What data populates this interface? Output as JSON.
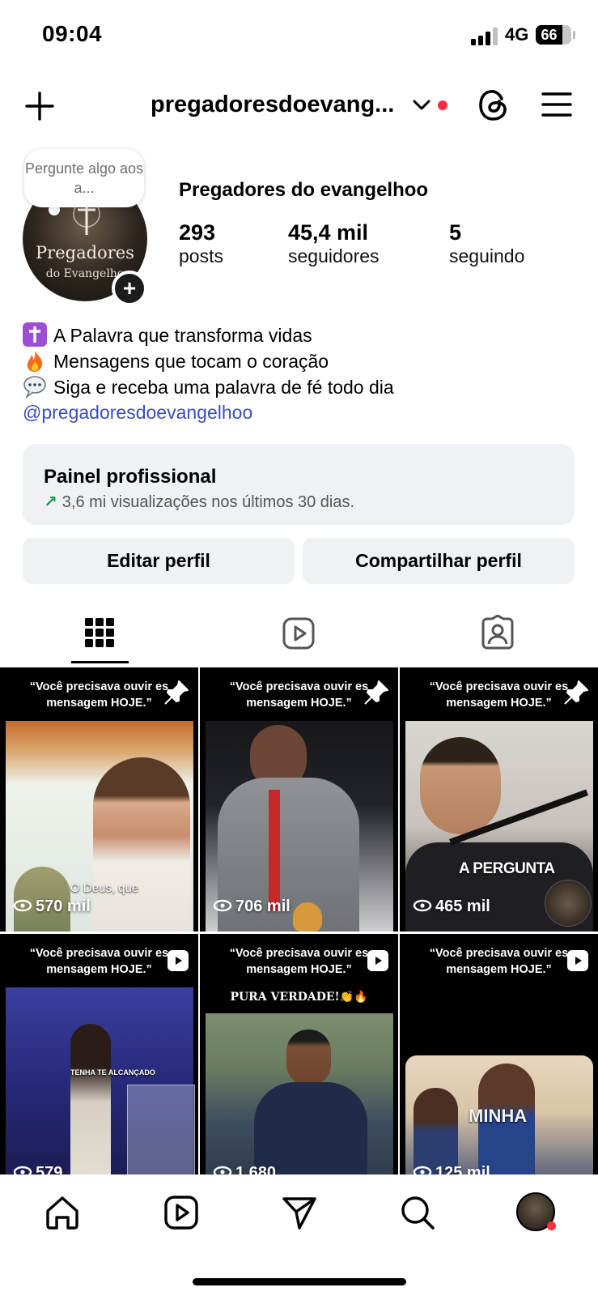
{
  "status_bar": {
    "time": "09:04",
    "network": "4G",
    "battery": "66"
  },
  "header": {
    "username": "pregadoresdoevang..."
  },
  "profile": {
    "name": "Pregadores do evangelhoo",
    "bubble_text": "Pergunte algo aos a...",
    "avatar_line1": "Pregadores",
    "avatar_line2": "do Evangelho",
    "stats": [
      {
        "value": "293",
        "label": "posts"
      },
      {
        "value": "45,4 mil",
        "label": "seguidores"
      },
      {
        "value": "5",
        "label": "seguindo"
      }
    ],
    "bio": [
      "A Palavra que transforma vidas",
      "Mensagens que tocam o coração",
      "Siga e receba uma palavra de fé todo dia"
    ],
    "bio_link": "@pregadoresdoevangelhoo"
  },
  "pro_panel": {
    "title": "Painel profissional",
    "subtitle": "3,6 mi visualizações nos últimos 30 dias."
  },
  "actions": {
    "edit": "Editar perfil",
    "share": "Compartilhar perfil"
  },
  "posts": [
    {
      "header": "“Você precisava ouvir es mensagem HOJE.”",
      "views": "570 mil",
      "caption": "O Deus, que",
      "badge": "pin"
    },
    {
      "header": "“Você precisava ouvir es mensagem HOJE.”",
      "views": "706 mil",
      "caption": "",
      "badge": "pin"
    },
    {
      "header": "“Você precisava ouvir es mensagem HOJE.”",
      "views": "465 mil",
      "caption": "A PERGUNTA",
      "badge": "pin"
    },
    {
      "header": "“Você precisava ouvir es mensagem HOJE.”",
      "views": "579",
      "caption": "TENHA TE ALCANÇADO",
      "badge": "reel"
    },
    {
      "header": "“Você precisava ouvir es mensagem HOJE.”",
      "views": "1.680",
      "caption": "PURA VERDADE!👏🔥",
      "badge": "reel"
    },
    {
      "header": "“Você precisava ouvir es mensagem HOJE.”",
      "views": "125 mil",
      "caption": "MINHA",
      "badge": "reel"
    }
  ],
  "colors": {
    "accent_link": "#3a4fb8",
    "notification": "#ff2d3e",
    "panel_bg": "#eff1f4",
    "growth": "#1f9e4c"
  },
  "icons": [
    "plus-icon",
    "chevron-down-icon",
    "threads-icon",
    "menu-icon",
    "grid-icon",
    "reels-icon",
    "tagged-icon",
    "home-icon",
    "search-icon",
    "send-icon"
  ]
}
